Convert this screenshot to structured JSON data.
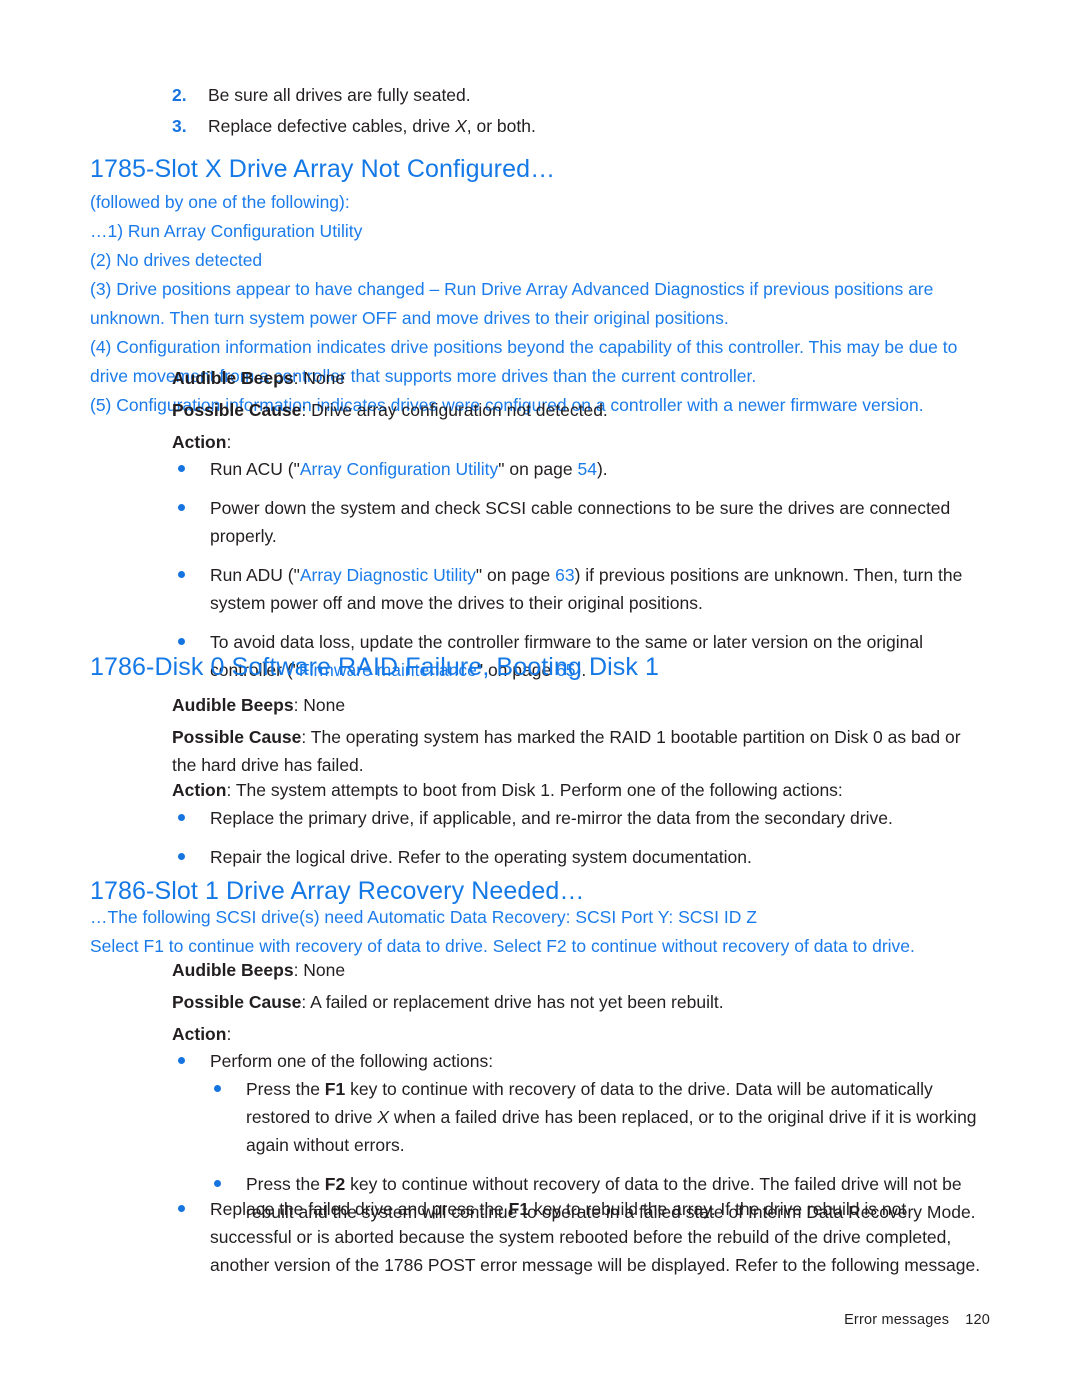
{
  "page": {
    "footer_label": "Error messages",
    "footer_page_number": "120",
    "accent_blue": "#1479e6",
    "link_blue": "#1b7bea",
    "text_color": "#231f20"
  },
  "numbered_steps": [
    {
      "marker": "2.",
      "text_before": "Be sure all drives are fully seated.",
      "italic": "",
      "text_after": ""
    },
    {
      "marker": "3.",
      "text_before": "Replace defective cables, drive ",
      "italic": "X",
      "text_after": ", or both."
    }
  ],
  "sections": [
    {
      "id": "1785-slot-x",
      "heading": "1785-Slot X Drive Array Not Configured…",
      "blue_lines": [
        "(followed by one of the following):",
        "…1) Run Array Configuration Utility",
        "(2) No drives detected",
        "(3) Drive positions appear to have changed – Run Drive Array Advanced Diagnostics if previous positions are unknown. Then turn system power OFF and move drives to their original positions.",
        "(4) Configuration information indicates drive positions beyond the capability of this controller. This may be due to drive movement from a controller that supports more drives than the current controller.",
        "(5) Configuration information indicates drives were configured on a controller with a newer firmware version."
      ],
      "audible_beeps_label": "Audible Beeps",
      "audible_beeps_value": ": None",
      "possible_cause_label": "Possible Cause",
      "possible_cause_value": ": Drive array configuration not detected.",
      "action_label": "Action",
      "action_value": ":",
      "bullets": [
        {
          "pre": "Run ACU (\"",
          "link": "Array Configuration Utility",
          "mid": "\" on page ",
          "page": "54",
          "post": ")."
        },
        {
          "pre": "Power down the system and check SCSI cable connections to be sure the drives are connected properly.",
          "link": "",
          "mid": "",
          "page": "",
          "post": ""
        },
        {
          "pre": "Run ADU (\"",
          "link": "Array Diagnostic Utility",
          "mid": "\" on page ",
          "page": "63",
          "post": ") if previous positions are unknown. Then, turn the system power off and move the drives to their original positions."
        },
        {
          "pre": "To avoid data loss, update the controller firmware to the same or later version on the original controller (\"",
          "link": "Firmware maintenance",
          "mid": "\" on page ",
          "page": "65",
          "post": ")."
        }
      ]
    },
    {
      "id": "1786-disk-0",
      "heading": "1786-Disk 0 Software RAID Failure, Booting Disk 1",
      "audible_beeps_label": "Audible Beeps",
      "audible_beeps_value": ": None",
      "possible_cause_label": "Possible Cause",
      "possible_cause_value": ": The operating system has marked the RAID 1 bootable partition on Disk 0 as bad or the hard drive has failed.",
      "action_label": "Action",
      "action_value": ": The system attempts to boot from Disk 1. Perform one of the following actions:",
      "bullets": [
        {
          "text": "Replace the primary drive, if applicable, and re-mirror the data from the secondary drive."
        },
        {
          "text": "Repair the logical drive. Refer to the operating system documentation."
        }
      ]
    },
    {
      "id": "1786-slot-1",
      "heading": "1786-Slot 1 Drive Array Recovery Needed…",
      "blue_lines": [
        "…The following SCSI drive(s) need Automatic Data Recovery: SCSI Port Y: SCSI ID Z",
        "Select F1 to continue with recovery of data to drive. Select F2 to continue without recovery of data to drive."
      ],
      "audible_beeps_label": "Audible Beeps",
      "audible_beeps_value": ": None",
      "possible_cause_label": "Possible Cause",
      "possible_cause_value": ": A failed or replacement drive has not yet been rebuilt.",
      "action_label": "Action",
      "action_value": ":",
      "lead_bullet": "Perform one of the following actions:",
      "sub_bullets": [
        {
          "pre": "Press the ",
          "key": "F1",
          "mid": " key to continue with recovery of data to the drive. Data will be automatically restored to drive ",
          "italic": "X",
          "post": " when a failed drive has been replaced, or to the original drive if it is working again without errors."
        },
        {
          "pre": "Press the ",
          "key": "F2",
          "mid": " key to continue without recovery of data to the drive. The failed drive will not be rebuilt and the system will continue to operate in a failed state of Interim Data Recovery Mode.",
          "italic": "",
          "post": ""
        }
      ],
      "final_bullet": {
        "pre": "Replace the failed drive and press the ",
        "key": "F1",
        "post": " key to rebuild the array. If the drive rebuild is not successful or is aborted because the system rebooted before the rebuild of the drive completed, another version of the 1786 POST error message will be displayed. Refer to the following message."
      }
    }
  ]
}
